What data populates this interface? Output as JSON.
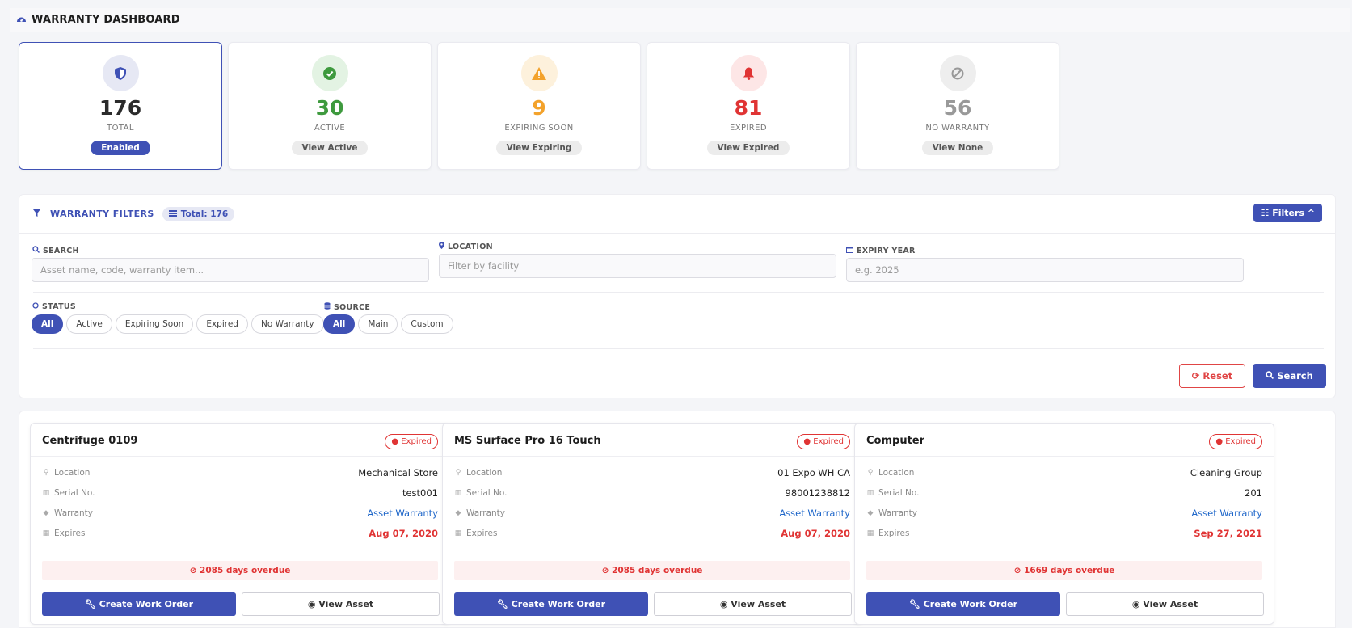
{
  "header": {
    "icon": "dashboard-gauge-icon",
    "title": "WARRANTY DASHBOARD"
  },
  "stats": [
    {
      "icon": "shield-icon",
      "value": "176",
      "label": "TOTAL",
      "button": "Enabled",
      "color": "#3f51b5",
      "icon_bg": "#e6e8f4",
      "selected": true
    },
    {
      "icon": "check-circle-icon",
      "value": "30",
      "label": "ACTIVE",
      "button": "View Active",
      "color": "#3e9a3e",
      "icon_bg": "#e3f3e3"
    },
    {
      "icon": "warning-triangle-icon",
      "value": "9",
      "label": "EXPIRING SOON",
      "button": "View Expiring",
      "color": "#f3a22b",
      "icon_bg": "#fdf1dc"
    },
    {
      "icon": "bell-icon",
      "value": "81",
      "label": "EXPIRED",
      "button": "View Expired",
      "color": "#e03434",
      "icon_bg": "#fde6e6"
    },
    {
      "icon": "ban-icon",
      "value": "56",
      "label": "NO WARRANTY",
      "button": "View None",
      "color": "#999999",
      "icon_bg": "#eeeeee"
    }
  ],
  "filters": {
    "title": "WARRANTY FILTERS",
    "total": "Total: 176",
    "toggle": "Filters",
    "search": {
      "label": "SEARCH",
      "placeholder": "Asset name, code, warranty item..."
    },
    "location": {
      "label": "LOCATION",
      "placeholder": "Filter by facility"
    },
    "expiry": {
      "label": "EXPIRY YEAR",
      "placeholder": "e.g. 2025"
    },
    "status": {
      "label": "STATUS",
      "options": [
        "All",
        "Active",
        "Expiring Soon",
        "Expired",
        "No Warranty"
      ],
      "selected": "All"
    },
    "source": {
      "label": "SOURCE",
      "options": [
        "All",
        "Main",
        "Custom"
      ],
      "selected": "All"
    },
    "reset": "Reset",
    "search_btn": "Search"
  },
  "cards": [
    {
      "title": "Centrifuge 0109",
      "badge": "Expired",
      "location_label": "Location",
      "location": "Mechanical Store",
      "serial_label": "Serial No.",
      "serial": "test001",
      "warranty_label": "Warranty",
      "warranty": "Asset Warranty",
      "expires_label": "Expires",
      "expires": "Aug 07, 2020",
      "overdue": "2085 days overdue",
      "btn1": "Create Work Order",
      "btn2": "View Asset"
    },
    {
      "title": "MS Surface Pro 16 Touch",
      "badge": "Expired",
      "location_label": "Location",
      "location": "01 Expo WH CA",
      "serial_label": "Serial No.",
      "serial": "98001238812",
      "warranty_label": "Warranty",
      "warranty": "Asset Warranty",
      "expires_label": "Expires",
      "expires": "Aug 07, 2020",
      "overdue": "2085 days overdue",
      "btn1": "Create Work Order",
      "btn2": "View Asset"
    },
    {
      "title": "Computer",
      "badge": "Expired",
      "location_label": "Location",
      "location": "Cleaning Group",
      "serial_label": "Serial No.",
      "serial": "201",
      "warranty_label": "Warranty",
      "warranty": "Asset Warranty",
      "expires_label": "Expires",
      "expires": "Sep 27, 2021",
      "overdue": "1669 days overdue",
      "btn1": "Create Work Order",
      "btn2": "View Asset"
    }
  ]
}
